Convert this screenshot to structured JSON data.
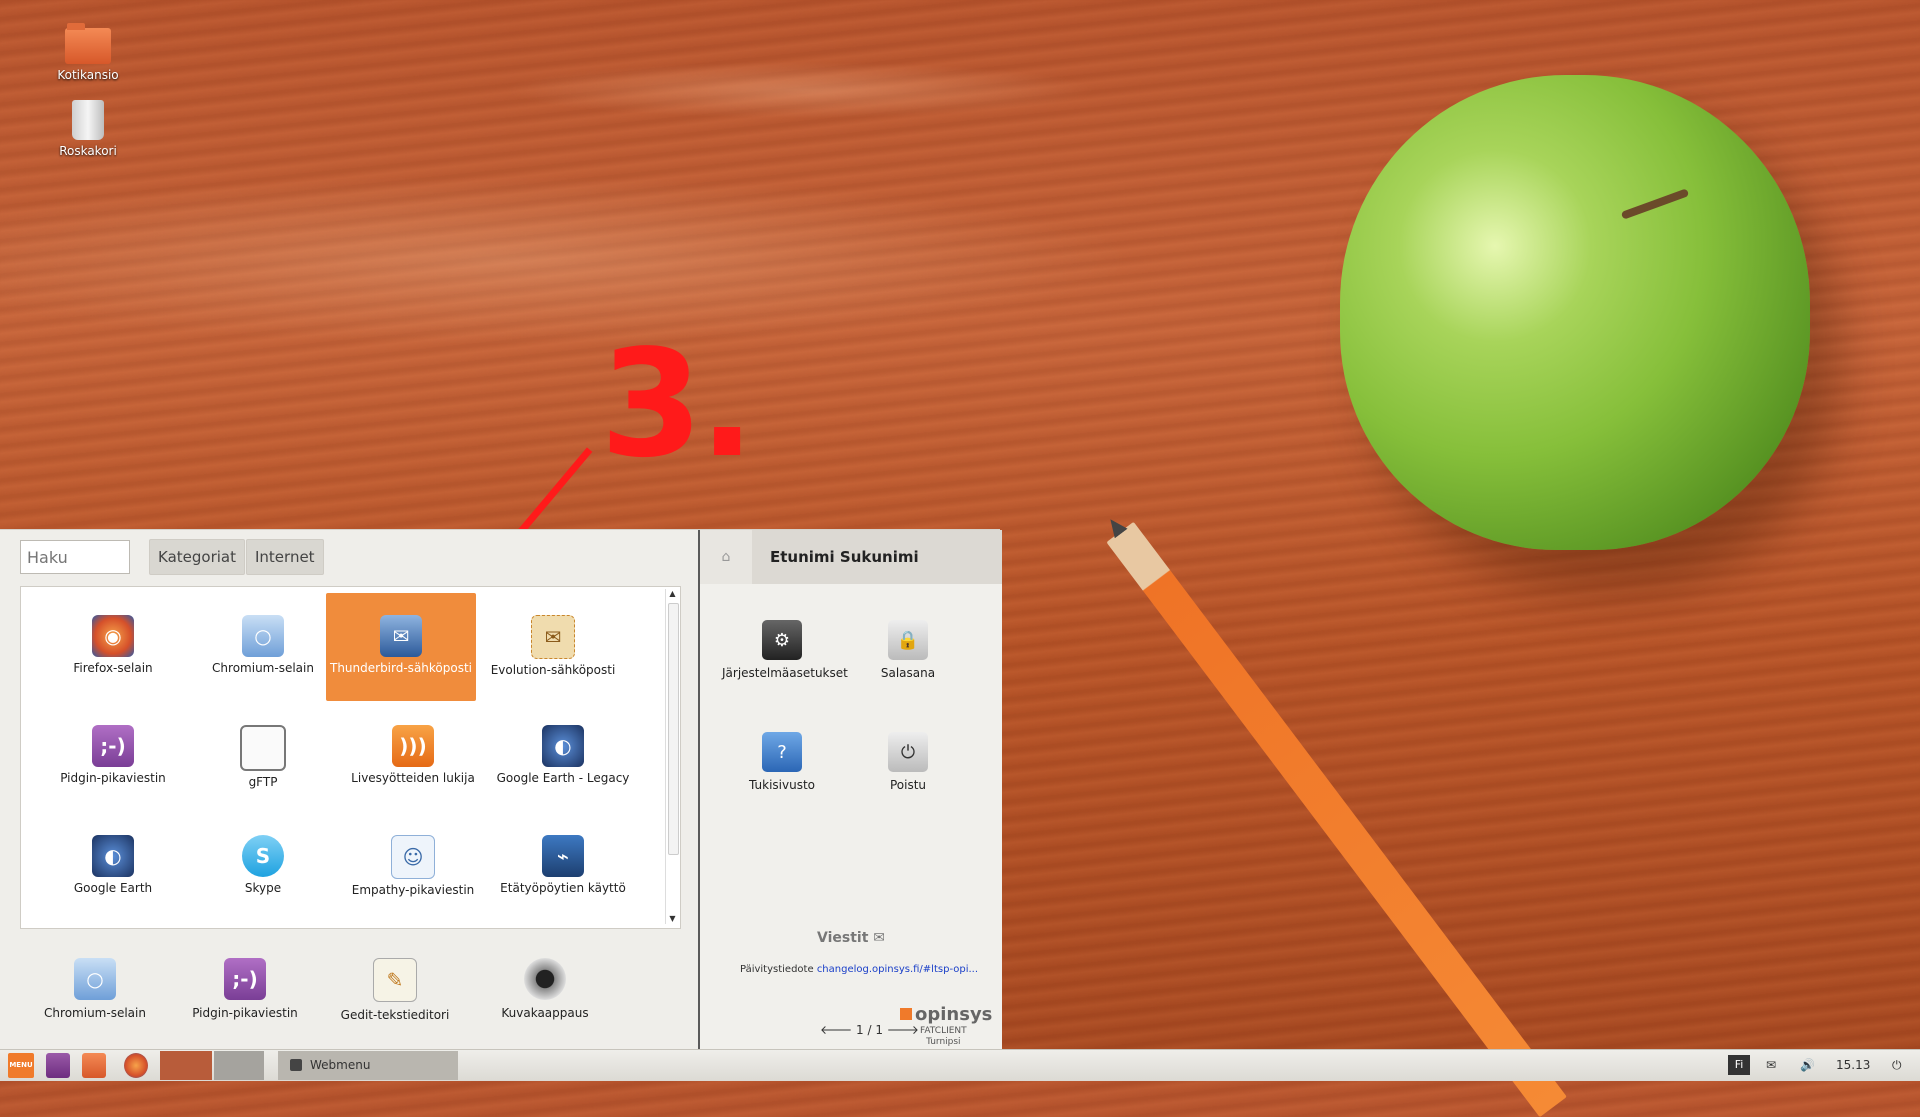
{
  "desktop": {
    "icons": [
      {
        "label": "Kotikansio",
        "icon": "home-folder-icon"
      },
      {
        "label": "Roskakori",
        "icon": "trash-icon"
      }
    ]
  },
  "annotation": {
    "label": "3.",
    "color": "#ff1a1a"
  },
  "menu": {
    "search": {
      "placeholder": "Haku"
    },
    "breadcrumb": [
      "Kategoriat",
      "Internet"
    ],
    "apps": [
      {
        "label": "Firefox-selain",
        "icon": "firefox-icon",
        "selected": false
      },
      {
        "label": "Chromium-selain",
        "icon": "chromium-icon",
        "selected": false
      },
      {
        "label": "Thunderbird-sähköposti",
        "icon": "thunderbird-icon",
        "selected": true
      },
      {
        "label": "Evolution-sähköposti",
        "icon": "evolution-icon",
        "selected": false
      },
      {
        "label": "Pidgin-pikaviestin",
        "icon": "pidgin-icon",
        "selected": false
      },
      {
        "label": "gFTP",
        "icon": "gftp-icon",
        "selected": false
      },
      {
        "label": "Livesyötteiden lukija",
        "icon": "rss-icon",
        "selected": false
      },
      {
        "label": "Google Earth - Legacy",
        "icon": "google-earth-icon",
        "selected": false
      },
      {
        "label": "Google Earth",
        "icon": "google-earth-icon",
        "selected": false
      },
      {
        "label": "Skype",
        "icon": "skype-icon",
        "selected": false
      },
      {
        "label": "Empathy-pikaviestin",
        "icon": "empathy-icon",
        "selected": false
      },
      {
        "label": "Etätyöpöytien käyttö",
        "icon": "remote-desktop-icon",
        "selected": false
      }
    ],
    "favorites": [
      {
        "label": "Chromium-selain",
        "icon": "chromium-icon"
      },
      {
        "label": "Pidgin-pikaviestin",
        "icon": "pidgin-icon"
      },
      {
        "label": "Gedit-tekstieditori",
        "icon": "gedit-icon"
      },
      {
        "label": "Kuvakaappaus",
        "icon": "camera-icon"
      }
    ],
    "user": {
      "name": "Etunimi Sukunimi"
    },
    "actions": [
      {
        "label": "Järjestelmäasetukset",
        "icon": "settings-icon"
      },
      {
        "label": "Salasana",
        "icon": "lock-icon"
      },
      {
        "label": "Tukisivusto",
        "icon": "help-icon"
      },
      {
        "label": "Poistu",
        "icon": "power-icon"
      }
    ],
    "messages": {
      "title": "Viestit",
      "prefix": "Päivitystiedote",
      "link": "changelog.opinsys.fi/#ltsp-opi..."
    },
    "pager": "1 / 1",
    "brand": {
      "name": "opinsys",
      "line1": "FATCLIENT",
      "line2": "Turnipsi"
    }
  },
  "taskbar": {
    "menu_label": "MENU",
    "window_title": "Webmenu",
    "keyboard_layout": "Fi",
    "clock": "15.13"
  }
}
